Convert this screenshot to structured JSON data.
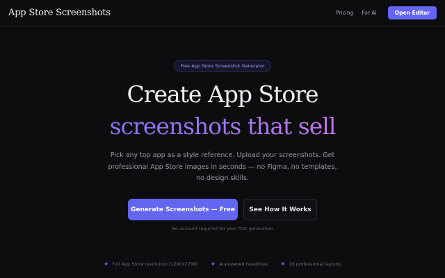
{
  "nav": {
    "brand": "App Store Screenshots",
    "links": [
      "Pricing",
      "For AI"
    ],
    "cta_label": "Open Editor"
  },
  "hero": {
    "badge": "Free App Store Screenshot Generator",
    "title_line1": "Create App Store",
    "title_line2": "screenshots that sell",
    "subtitle": "Pick any top app as a style reference. Upload your screenshots. Get professional App Store images in seconds — no Figma, no templates, no design skills.",
    "primary_cta": "Generate Screenshots — Free",
    "secondary_cta": "See How It Works",
    "note": "No account required for your first generation"
  },
  "features": [
    {
      "icon": "star-icon",
      "label": "Full App Store resolution (1290x2796)"
    },
    {
      "icon": "star-icon",
      "label": "AI-powered headlines"
    },
    {
      "icon": "star-icon",
      "label": "16 professional layouts"
    }
  ],
  "colors": {
    "background": "#0d0d10",
    "accent": "#6366f1",
    "gradient_start": "#6e70f2",
    "gradient_end": "#e07bdc"
  }
}
